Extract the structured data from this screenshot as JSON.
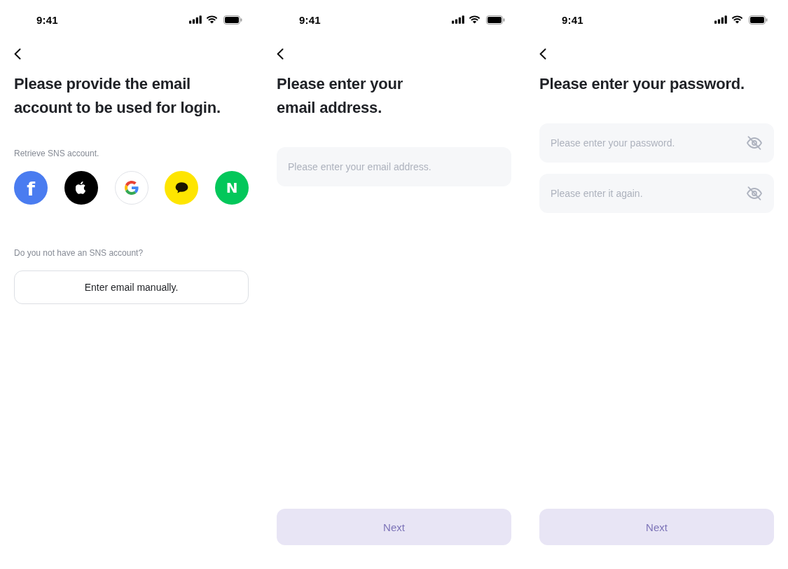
{
  "screens": [
    {
      "status_bar": {
        "time": "9:41"
      },
      "title": "Please provide the email\naccount to be used for login.",
      "sns_label": "Retrieve SNS account.",
      "sns_buttons": [
        {
          "kind": "facebook",
          "color": "#4a7cf0",
          "glyph": "f"
        },
        {
          "kind": "apple",
          "color": "#000000"
        },
        {
          "kind": "google",
          "color": "#ffffff"
        },
        {
          "kind": "kakao",
          "color": "#fee500"
        },
        {
          "kind": "naver",
          "color": "#03c75a",
          "glyph": "N"
        }
      ],
      "no_sns_label": "Do you not have an SNS account?",
      "manual_button": {
        "label": "Enter email manually."
      }
    },
    {
      "status_bar": {
        "time": "9:41"
      },
      "title": "Please enter your\nemail address.",
      "fields": [
        {
          "kind": "email",
          "placeholder": "Please enter your email address."
        }
      ],
      "next_button": {
        "label": "Next",
        "disabled": true
      }
    },
    {
      "status_bar": {
        "time": "9:41"
      },
      "title": "Please enter your password.",
      "fields": [
        {
          "kind": "password",
          "placeholder": "Please enter your password.",
          "revealed": false
        },
        {
          "kind": "password",
          "placeholder": "Please enter it again.",
          "revealed": false
        }
      ],
      "next_button": {
        "label": "Next",
        "disabled": true
      }
    }
  ]
}
